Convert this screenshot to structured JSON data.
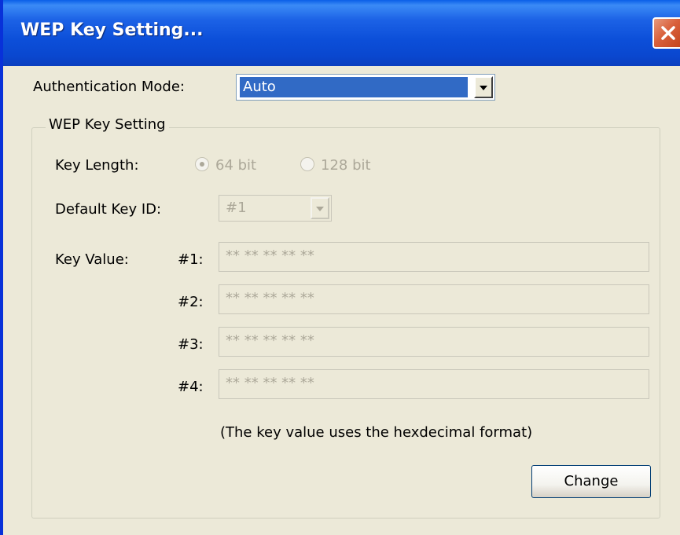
{
  "window": {
    "title": "WEP Key Setting..."
  },
  "auth": {
    "label": "Authentication Mode:",
    "value": "Auto"
  },
  "group": {
    "legend": "WEP Key Setting"
  },
  "key_length": {
    "label": "Key Length:",
    "options": [
      {
        "label": "64 bit",
        "selected": true
      },
      {
        "label": "128 bit",
        "selected": false
      }
    ]
  },
  "default_key": {
    "label": "Default Key ID:",
    "value": "#1"
  },
  "key_value": {
    "label": "Key Value:",
    "keys": [
      {
        "id": "#1:",
        "value": "** ** ** ** **"
      },
      {
        "id": "#2:",
        "value": "** ** ** ** **"
      },
      {
        "id": "#3:",
        "value": "** ** ** ** **"
      },
      {
        "id": "#4:",
        "value": "** ** ** ** **"
      }
    ]
  },
  "note": "(The key value uses the hexdecimal format)",
  "buttons": {
    "change": "Change"
  },
  "colors": {
    "titlebar": "#0a47cf",
    "selection": "#316ac5",
    "disabled_text": "#aca899",
    "dialog_bg": "#ece9d8",
    "close_button": "#d9603b"
  },
  "icons": {
    "close": "close-icon",
    "dropdown": "chevron-down-icon"
  }
}
